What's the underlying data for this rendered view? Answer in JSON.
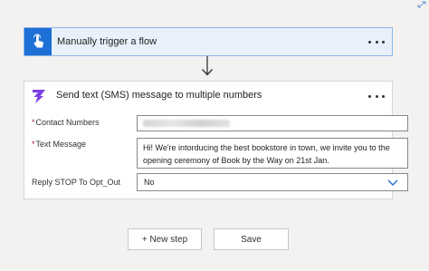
{
  "trigger": {
    "title": "Manually trigger a flow"
  },
  "action": {
    "title": "Send text (SMS) message to multiple numbers",
    "fields": {
      "contact_numbers": {
        "required_mark": "*",
        "label": "Contact Numbers"
      },
      "text_message": {
        "required_mark": "*",
        "label": "Text Message",
        "value": "Hi! We're intorducing the best bookstore in town, we invite you to the opening ceremony of Book by the Way on 21st Jan."
      },
      "reply_stop": {
        "label": "Reply STOP To Opt_Out",
        "value": "No"
      }
    }
  },
  "buttons": {
    "new_step": "+ New step",
    "save": "Save"
  },
  "colors": {
    "trigger_accent": "#1e6fd6",
    "trigger_bg": "#e8f1fb",
    "sms_icon": "#7b3fe4",
    "required": "#a4262c"
  },
  "icons": [
    "expand-icon",
    "touch-icon",
    "more-options-icon",
    "arrow-down-icon",
    "sms-icon",
    "chevron-down-icon"
  ]
}
